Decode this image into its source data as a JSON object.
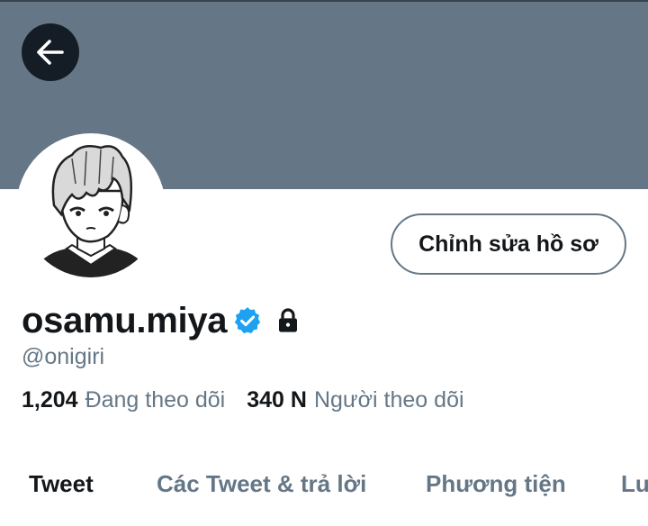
{
  "colors": {
    "banner": "#657786",
    "text_primary": "#14171a",
    "text_secondary": "#657786",
    "verified_blue": "#1da1f2"
  },
  "header": {
    "back_icon": "arrow-left-icon"
  },
  "profile": {
    "edit_button_label": "Chỉnh sửa hồ sơ",
    "display_name": "osamu.miya",
    "verified_icon": "verified-badge-icon",
    "lock_icon": "lock-icon",
    "handle": "@onigiri",
    "following_count": "1,204",
    "following_label": "Đang theo dõi",
    "followers_count": "340 N",
    "followers_label": "Người theo dõi"
  },
  "tabs": [
    {
      "label": "Tweet",
      "active": true
    },
    {
      "label": "Các Tweet & trả lời",
      "active": false
    },
    {
      "label": "Phương tiện",
      "active": false
    },
    {
      "label": "Lư",
      "active": false
    }
  ]
}
